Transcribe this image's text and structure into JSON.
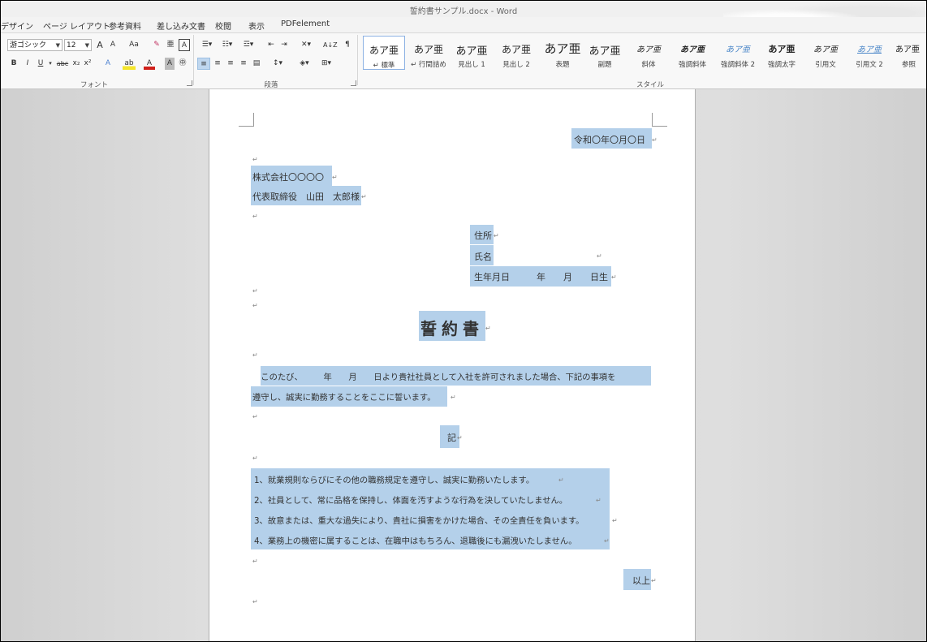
{
  "window": {
    "title": "誓約書サンプル.docx - Word"
  },
  "tabs": [
    "デザイン",
    "ページ レイアウト",
    "参考資料",
    "差し込み文書",
    "校閲",
    "表示",
    "PDFelement"
  ],
  "font_group": {
    "font_name": "游ゴシック",
    "font_size": "12",
    "grow": "A",
    "shrink": "A",
    "case": "Aa",
    "bold": "B",
    "italic": "I",
    "underline": "U",
    "strike": "abc",
    "subscript": "x₂",
    "superscript": "x²",
    "label": "フォント"
  },
  "paragraph_group": {
    "label": "段落",
    "sort": "A↓Z"
  },
  "styles_group": {
    "label": "スタイル",
    "items": [
      {
        "preview": "あア亜",
        "name": "↵ 標準"
      },
      {
        "preview": "あア亜",
        "name": "↵ 行間詰め"
      },
      {
        "preview": "あア亜",
        "name": "見出し 1"
      },
      {
        "preview": "あア亜",
        "name": "見出し 2"
      },
      {
        "preview": "あア亜",
        "name": "表題"
      },
      {
        "preview": "あア亜",
        "name": "副題"
      },
      {
        "preview": "あア亜",
        "name": "斜体"
      },
      {
        "preview": "あア亜",
        "name": "強調斜体"
      },
      {
        "preview": "あア亜",
        "name": "強調斜体 2"
      },
      {
        "preview": "あア亜",
        "name": "強調太字"
      },
      {
        "preview": "あア亜",
        "name": "引用文"
      },
      {
        "preview": "あア亜",
        "name": "引用文 2"
      },
      {
        "preview": "あア亜",
        "name": "参照"
      }
    ]
  },
  "document": {
    "date": "令和〇年〇月〇日",
    "company": "株式会社〇〇〇〇",
    "recipient": "代表取締役　山田　太郎様",
    "address_label": "住所",
    "name_label": "氏名",
    "birthdate_label": "生年月日　　　年　　月　　日生",
    "title": "誓約書",
    "intro_line1": "　このたび、　　　年　　月　　日より貴社社員として入社を許可されました場合、下記の事項を",
    "intro_line2": "遵守し、誠実に勤務することをここに誓います。",
    "ki": "記",
    "items": [
      "1、就業規則ならびにその他の職務規定を遵守し、誠実に勤務いたします。",
      "2、社員として、常に品格を保持し、体面を汚すような行為を決していたしません。",
      "3、故意または、重大な過失により、貴社に損害をかけた場合、その全責任を負います。",
      "4、業務上の機密に属することは、在職中はもちろん、退職後にも漏洩いたしません。"
    ],
    "closing": "以上",
    "paragraph_mark": "↵"
  },
  "colors": {
    "selection": "#b4d0ea",
    "ribbon": "#f8f8f8"
  }
}
